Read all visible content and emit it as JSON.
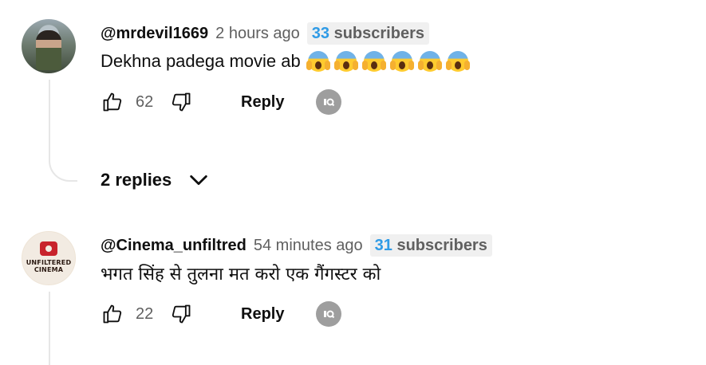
{
  "comments": [
    {
      "handle": "@mrdevil1669",
      "time": "2 hours ago",
      "subscriber_count": "33",
      "subscriber_label": "subscribers",
      "text": "Dekhna padega movie ab",
      "emoji": "😱",
      "emoji_count": 6,
      "likes": "62",
      "reply_label": "Reply",
      "avatar_icon": "profile-photo-soldier"
    },
    {
      "handle": "@Cinema_unfiltred",
      "time": "54 minutes ago",
      "subscriber_count": "31",
      "subscriber_label": "subscribers",
      "text": "भगत सिंह से तुलना मत करो एक गैंगस्टर को",
      "likes": "22",
      "reply_label": "Reply",
      "avatar_icon": "unfiltered-cinema-logo",
      "avatar_logo_text": "UNFILTERED CINEMA"
    }
  ],
  "replies_toggle": {
    "label": "2 replies",
    "icon": "chevron-down-icon"
  },
  "colors": {
    "subscriber_count": "#2f9be6",
    "badge_bg": "#f0f0f0",
    "muted_text": "#606060",
    "ai_icon_bg": "#9e9e9e",
    "thread_line": "#e6e6e6"
  }
}
